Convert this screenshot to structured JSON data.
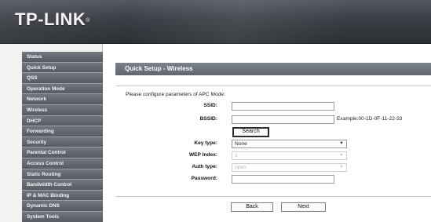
{
  "header": {
    "logo_text": "TP-LINK",
    "logo_mark": "®"
  },
  "sidebar": {
    "items": [
      {
        "label": "Status"
      },
      {
        "label": "Quick Setup"
      },
      {
        "label": "QSS"
      },
      {
        "label": "Operation Mode"
      },
      {
        "label": "Network"
      },
      {
        "label": "Wireless"
      },
      {
        "label": "DHCP"
      },
      {
        "label": "Forwarding"
      },
      {
        "label": "Security"
      },
      {
        "label": "Parental Control"
      },
      {
        "label": "Access Control"
      },
      {
        "label": "Static Routing"
      },
      {
        "label": "Bandwidth Control"
      },
      {
        "label": "IP & MAC Binding"
      },
      {
        "label": "Dynamic DNS"
      },
      {
        "label": "System Tools"
      }
    ]
  },
  "page": {
    "title": "Quick Setup - Wireless",
    "intro": "Please configure parameters of APC Mode:"
  },
  "form": {
    "ssid_label": "SSID:",
    "ssid_value": "",
    "bssid_label": "BSSID:",
    "bssid_value": "",
    "bssid_example": "Example:00-1D-0F-11-22-33",
    "search_label": "Search",
    "key_type_label": "Key type:",
    "key_type_value": "None",
    "wep_index_label": "WEP Index:",
    "wep_index_value": "1",
    "auth_type_label": "Auth type:",
    "auth_type_value": "open",
    "password_label": "Password:",
    "password_value": ""
  },
  "buttons": {
    "back_label": "Back",
    "next_label": "Next"
  }
}
